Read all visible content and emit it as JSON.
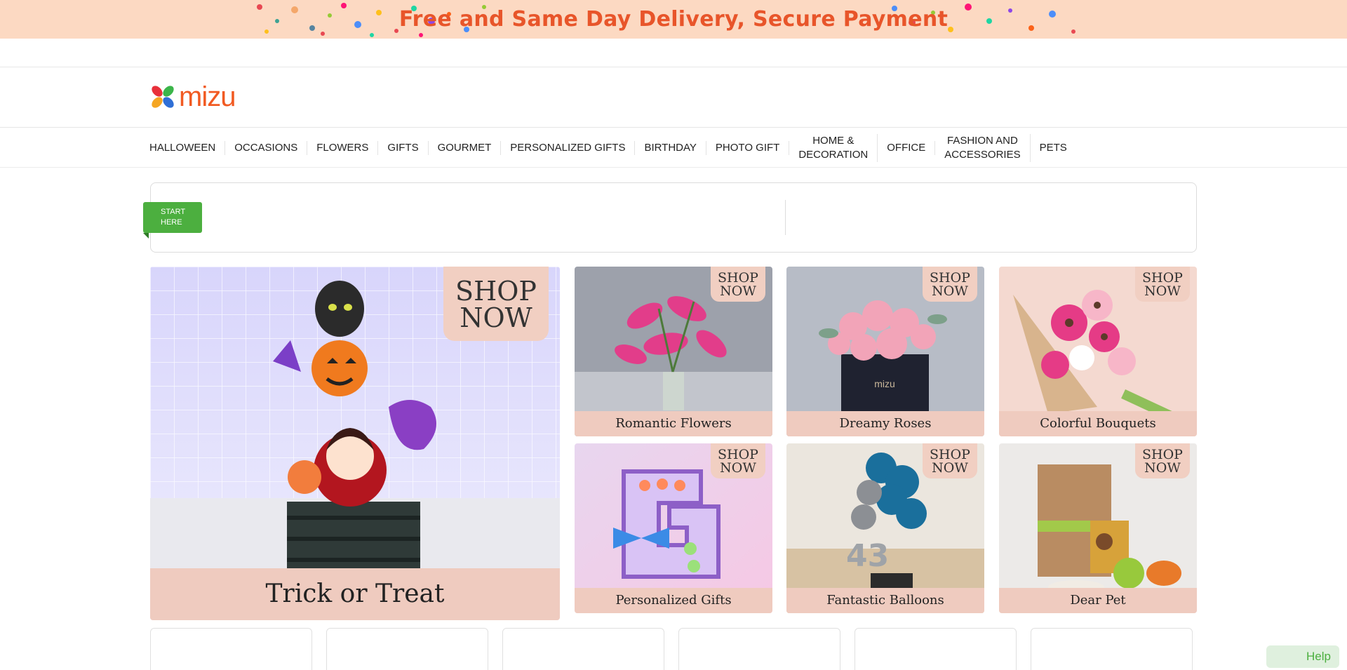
{
  "promo": {
    "text": "Free and Same Day Delivery, Secure Payment",
    "background": "#fcd9c2",
    "text_color": "#e8552a"
  },
  "header": {
    "logo_text": "mizu",
    "logo_icon": "flower-petals-icon"
  },
  "nav": {
    "items": [
      "HALLOWEEN",
      "OCCASIONS",
      "FLOWERS",
      "GIFTS",
      "GOURMET",
      "PERSONALIZED GIFTS",
      "BIRTHDAY",
      "PHOTO GIFT",
      "HOME &\nDECORATION",
      "OFFICE",
      "FASHION AND\nACCESSORIES",
      "PETS"
    ]
  },
  "start": {
    "tag_label": "START\nHERE",
    "accent": "#4caf3f"
  },
  "tiles": {
    "shop_now": "SHOP\nNOW",
    "featured": "Trick or Treat",
    "items": [
      "Romantic Flowers",
      "Dreamy Roses",
      "Colorful Bouquets",
      "Personalized Gifts",
      "Fantastic Balloons",
      "Dear Pet"
    ],
    "caption_color": "#efcbbf"
  },
  "help": {
    "label": "Help"
  }
}
